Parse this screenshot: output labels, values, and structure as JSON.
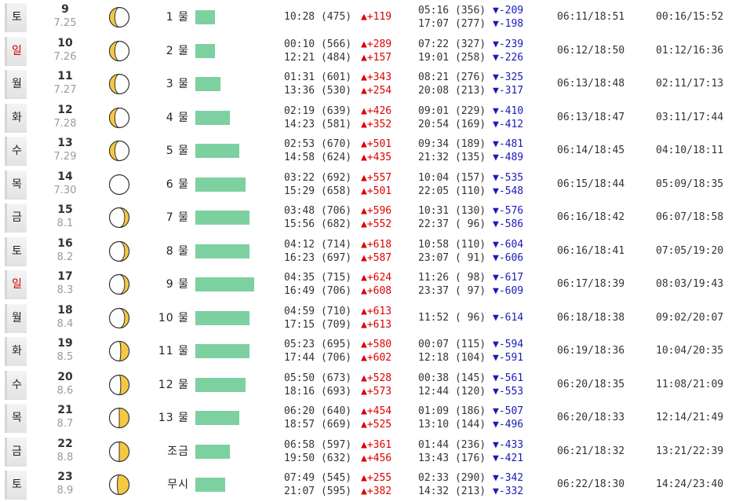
{
  "rows": [
    {
      "dow": "토",
      "dow_red": false,
      "day": "9",
      "lunar": "7.25",
      "phase": "waning-crescent-left",
      "tide": "1 물",
      "bar": 0.33,
      "high": [
        "10:28 (475)"
      ],
      "high_diff": [
        "▲+119"
      ],
      "low": [
        "05:16 (356)",
        "17:07 (277)"
      ],
      "low_diff": [
        "▼-209",
        "▼-198"
      ],
      "sun": "06:11/18:51",
      "moon": "00:16/15:52"
    },
    {
      "dow": "일",
      "dow_red": true,
      "day": "10",
      "lunar": "7.26",
      "phase": "waning-crescent-left",
      "tide": "2 물",
      "bar": 0.33,
      "high": [
        "00:10 (566)",
        "12:21 (484)"
      ],
      "high_diff": [
        "▲+289",
        "▲+157"
      ],
      "low": [
        "07:22 (327)",
        "19:01 (258)"
      ],
      "low_diff": [
        "▼-239",
        "▼-226"
      ],
      "sun": "06:12/18:50",
      "moon": "01:12/16:36"
    },
    {
      "dow": "월",
      "dow_red": false,
      "day": "11",
      "lunar": "7.27",
      "phase": "waning-crescent-left",
      "tide": "3 물",
      "bar": 0.43,
      "high": [
        "01:31 (601)",
        "13:36 (530)"
      ],
      "high_diff": [
        "▲+343",
        "▲+254"
      ],
      "low": [
        "08:21 (276)",
        "20:08 (213)"
      ],
      "low_diff": [
        "▼-325",
        "▼-317"
      ],
      "sun": "06:13/18:48",
      "moon": "02:11/17:13"
    },
    {
      "dow": "화",
      "dow_red": false,
      "day": "12",
      "lunar": "7.28",
      "phase": "waning-crescent-left",
      "tide": "4 물",
      "bar": 0.58,
      "high": [
        "02:19 (639)",
        "14:23 (581)"
      ],
      "high_diff": [
        "▲+426",
        "▲+352"
      ],
      "low": [
        "09:01 (229)",
        "20:54 (169)"
      ],
      "low_diff": [
        "▼-410",
        "▼-412"
      ],
      "sun": "06:13/18:47",
      "moon": "03:11/17:44"
    },
    {
      "dow": "수",
      "dow_red": false,
      "day": "13",
      "lunar": "7.29",
      "phase": "waning-crescent-left",
      "tide": "5 물",
      "bar": 0.75,
      "high": [
        "02:53 (670)",
        "14:58 (624)"
      ],
      "high_diff": [
        "▲+501",
        "▲+435"
      ],
      "low": [
        "09:34 (189)",
        "21:32 (135)"
      ],
      "low_diff": [
        "▼-481",
        "▼-489"
      ],
      "sun": "06:14/18:45",
      "moon": "04:10/18:11"
    },
    {
      "dow": "목",
      "dow_red": false,
      "day": "14",
      "lunar": "7.30",
      "phase": "new",
      "tide": "6 물",
      "bar": 0.85,
      "high": [
        "03:22 (692)",
        "15:29 (658)"
      ],
      "high_diff": [
        "▲+557",
        "▲+501"
      ],
      "low": [
        "10:04 (157)",
        "22:05 (110)"
      ],
      "low_diff": [
        "▼-535",
        "▼-548"
      ],
      "sun": "06:15/18:44",
      "moon": "05:09/18:35"
    },
    {
      "dow": "금",
      "dow_red": false,
      "day": "15",
      "lunar": "8.1",
      "phase": "waxing-crescent-right",
      "tide": "7 물",
      "bar": 0.92,
      "high": [
        "03:48 (706)",
        "15:56 (682)"
      ],
      "high_diff": [
        "▲+596",
        "▲+552"
      ],
      "low": [
        "10:31 (130)",
        "22:37 ( 96)"
      ],
      "low_diff": [
        "▼-576",
        "▼-586"
      ],
      "sun": "06:16/18:42",
      "moon": "06:07/18:58"
    },
    {
      "dow": "토",
      "dow_red": false,
      "day": "16",
      "lunar": "8.2",
      "phase": "waxing-crescent-right",
      "tide": "8 물",
      "bar": 0.92,
      "high": [
        "04:12 (714)",
        "16:23 (697)"
      ],
      "high_diff": [
        "▲+618",
        "▲+587"
      ],
      "low": [
        "10:58 (110)",
        "23:07 ( 91)"
      ],
      "low_diff": [
        "▼-604",
        "▼-606"
      ],
      "sun": "06:16/18:41",
      "moon": "07:05/19:20"
    },
    {
      "dow": "일",
      "dow_red": true,
      "day": "17",
      "lunar": "8.3",
      "phase": "waxing-crescent-right",
      "tide": "9 물",
      "bar": 1.0,
      "high": [
        "04:35 (715)",
        "16:49 (706)"
      ],
      "high_diff": [
        "▲+624",
        "▲+608"
      ],
      "low": [
        "11:26 ( 98)",
        "23:37 ( 97)"
      ],
      "low_diff": [
        "▼-617",
        "▼-609"
      ],
      "sun": "06:17/18:39",
      "moon": "08:03/19:43"
    },
    {
      "dow": "월",
      "dow_red": false,
      "day": "18",
      "lunar": "8.4",
      "phase": "waxing-crescent-right",
      "tide": "10 물",
      "bar": 0.92,
      "high": [
        "04:59 (710)",
        "17:15 (709)"
      ],
      "high_diff": [
        "▲+613",
        "▲+613"
      ],
      "low": [
        "11:52 ( 96)"
      ],
      "low_diff": [
        "▼-614"
      ],
      "sun": "06:18/18:38",
      "moon": "09:02/20:07"
    },
    {
      "dow": "화",
      "dow_red": false,
      "day": "19",
      "lunar": "8.5",
      "phase": "first-quarter-ish",
      "tide": "11 물",
      "bar": 0.92,
      "high": [
        "05:23 (695)",
        "17:44 (706)"
      ],
      "high_diff": [
        "▲+580",
        "▲+602"
      ],
      "low": [
        "00:07 (115)",
        "12:18 (104)"
      ],
      "low_diff": [
        "▼-594",
        "▼-591"
      ],
      "sun": "06:19/18:36",
      "moon": "10:04/20:35"
    },
    {
      "dow": "수",
      "dow_red": false,
      "day": "20",
      "lunar": "8.6",
      "phase": "first-quarter-ish",
      "tide": "12 물",
      "bar": 0.85,
      "high": [
        "05:50 (673)",
        "18:16 (693)"
      ],
      "high_diff": [
        "▲+528",
        "▲+573"
      ],
      "low": [
        "00:38 (145)",
        "12:44 (120)"
      ],
      "low_diff": [
        "▼-561",
        "▼-553"
      ],
      "sun": "06:20/18:35",
      "moon": "11:08/21:09"
    },
    {
      "dow": "목",
      "dow_red": false,
      "day": "21",
      "lunar": "8.7",
      "phase": "first-quarter",
      "tide": "13 물",
      "bar": 0.75,
      "high": [
        "06:20 (640)",
        "18:57 (669)"
      ],
      "high_diff": [
        "▲+454",
        "▲+525"
      ],
      "low": [
        "01:09 (186)",
        "13:10 (144)"
      ],
      "low_diff": [
        "▼-507",
        "▼-496"
      ],
      "sun": "06:20/18:33",
      "moon": "12:14/21:49"
    },
    {
      "dow": "금",
      "dow_red": false,
      "day": "22",
      "lunar": "8.8",
      "phase": "first-quarter",
      "tide": "조금",
      "bar": 0.58,
      "high": [
        "06:58 (597)",
        "19:50 (632)"
      ],
      "high_diff": [
        "▲+361",
        "▲+456"
      ],
      "low": [
        "01:44 (236)",
        "13:43 (176)"
      ],
      "low_diff": [
        "▼-433",
        "▼-421"
      ],
      "sun": "06:21/18:32",
      "moon": "13:21/22:39"
    },
    {
      "dow": "토",
      "dow_red": false,
      "day": "23",
      "lunar": "8.9",
      "phase": "waxing-gibbous",
      "tide": "무시",
      "bar": 0.5,
      "high": [
        "07:49 (545)",
        "21:07 (595)"
      ],
      "high_diff": [
        "▲+255",
        "▲+382"
      ],
      "low": [
        "02:33 (290)",
        "14:32 (213)"
      ],
      "low_diff": [
        "▼-342",
        "▼-332"
      ],
      "sun": "06:22/18:30",
      "moon": "14:24/23:40"
    }
  ],
  "colors": {
    "bar": "#7dd0a0",
    "up": "#dd0000",
    "down": "#1a1ab8",
    "moon_fill": "#f5c842"
  }
}
